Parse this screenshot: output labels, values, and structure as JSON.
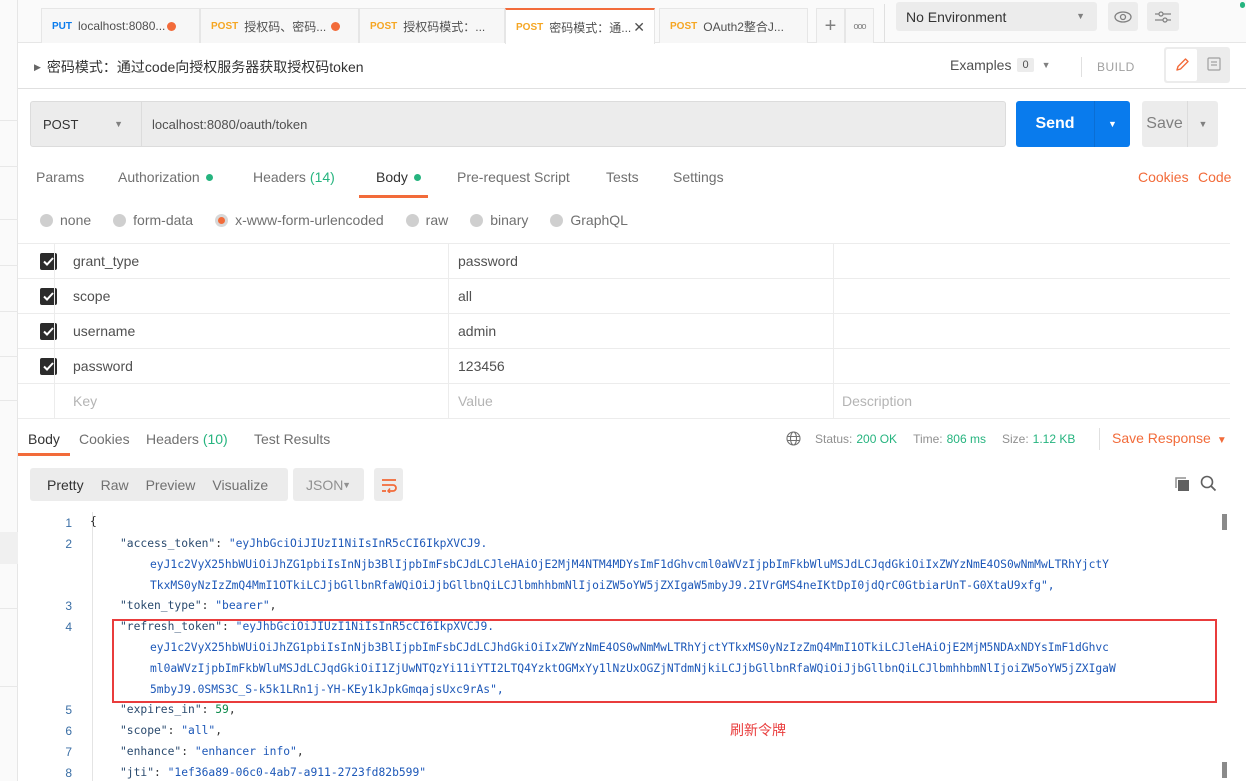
{
  "tabs": [
    {
      "method": "PUT",
      "title": "localhost:8080...",
      "unsaved": true,
      "active": false
    },
    {
      "method": "POST",
      "title": "授权码、密码...",
      "unsaved": true,
      "active": false
    },
    {
      "method": "POST",
      "title": "授权码模式：...",
      "unsaved": false,
      "active": false
    },
    {
      "method": "POST",
      "title": "密码模式：通...",
      "unsaved": false,
      "active": true,
      "close": "✕"
    },
    {
      "method": "POST",
      "title": "OAuth2整合J...",
      "unsaved": false,
      "active": false
    }
  ],
  "tabbar": {
    "add_label": "+",
    "more_label": "ooo"
  },
  "environment": {
    "selected": "No Environment"
  },
  "request": {
    "name": "密码模式：通过code向授权服务器获取授权码token",
    "examples_label": "Examples",
    "examples_count": "0",
    "build_label": "BUILD",
    "method": "POST",
    "url": "localhost:8080/oauth/token",
    "send_label": "Send",
    "save_label": "Save"
  },
  "request_tabs": [
    {
      "label": "Params"
    },
    {
      "label": "Authorization",
      "dot": true
    },
    {
      "label": "Headers",
      "count": "(14)"
    },
    {
      "label": "Body",
      "dot": true,
      "active": true
    },
    {
      "label": "Pre-request Script"
    },
    {
      "label": "Tests"
    },
    {
      "label": "Settings"
    }
  ],
  "links": {
    "cookies": "Cookies",
    "code": "Code"
  },
  "body_types": [
    {
      "label": "none"
    },
    {
      "label": "form-data"
    },
    {
      "label": "x-www-form-urlencoded",
      "selected": true
    },
    {
      "label": "raw"
    },
    {
      "label": "binary"
    },
    {
      "label": "GraphQL"
    }
  ],
  "params": [
    {
      "key": "grant_type",
      "value": "password",
      "checked": true
    },
    {
      "key": "scope",
      "value": "all",
      "checked": true
    },
    {
      "key": "username",
      "value": "admin",
      "checked": true
    },
    {
      "key": "password",
      "value": "123456",
      "checked": true
    }
  ],
  "params_placeholder": {
    "key": "Key",
    "value": "Value",
    "description": "Description"
  },
  "response_tabs": [
    {
      "label": "Body",
      "active": true
    },
    {
      "label": "Cookies"
    },
    {
      "label": "Headers",
      "count": "(10)"
    },
    {
      "label": "Test Results"
    }
  ],
  "response_status": {
    "status_label": "Status:",
    "status": "200 OK",
    "time_label": "Time:",
    "time": "806 ms",
    "size_label": "Size:",
    "size": "1.12 KB",
    "save_response": "Save Response"
  },
  "view_modes": [
    {
      "label": "Pretty",
      "active": true
    },
    {
      "label": "Raw"
    },
    {
      "label": "Preview"
    },
    {
      "label": "Visualize"
    }
  ],
  "format": {
    "selected": "JSON"
  },
  "code_lines": {
    "l1": {
      "num": "1",
      "text": "{"
    },
    "l2": {
      "num": "2",
      "key": "\"access_token\"",
      "sep": ": ",
      "parts": [
        "\"eyJhbGciOiJIUzI1NiIsInR5cCI6IkpXVCJ9.",
        "eyJ1c2VyX25hbWUiOiJhZG1pbiIsInNjb3BlIjpbImFsbCJdLCJleHAiOjE2MjM4NTM4MDYsImF1dGhvcml0aWVzIjpbImFkbWluMSJdLCJqdGkiOiIxZWYzNmE4OS0wNmMwLTRhYjctY",
        "TkxMS0yNzIzZmQ4MmI1OTkiLCJjbGllbnRfaWQiOiJjbGllbnQiLCJlbmhhbmNlIjoiZW5oYW5jZXIgaW5mbyJ9.2IVrGMS4neIKtDpI0jdQrC0GtbiarUnT-G0XtaU9xfg\","
      ]
    },
    "l3": {
      "num": "3",
      "key": "\"token_type\"",
      "sep": ": ",
      "value": "\"bearer\"",
      "end": ","
    },
    "l4": {
      "num": "4",
      "key": "\"refresh_token\"",
      "sep": ": ",
      "parts": [
        "\"eyJhbGciOiJIUzI1NiIsInR5cCI6IkpXVCJ9.",
        "eyJ1c2VyX25hbWUiOiJhZG1pbiIsInNjb3BlIjpbImFsbCJdLCJhdGkiOiIxZWYzNmE4OS0wNmMwLTRhYjctYTkxMS0yNzIzZmQ4MmI1OTkiLCJleHAiOjE2MjM5NDAxNDYsImF1dGhvc",
        "ml0aWVzIjpbImFkbWluMSJdLCJqdGkiOiI1ZjUwNTQzYi11iYTI2LTQ4YzktOGMxYy1lNzUxOGZjNTdmNjkiLCJjbGllbnRfaWQiOiJjbGllbnQiLCJlbmhhbmNlIjoiZW5oYW5jZXIgaW",
        "5mbyJ9.0SMS3C_S-k5k1LRn1j-YH-KEy1kJpkGmqajsUxc9rAs\","
      ]
    },
    "l5": {
      "num": "5",
      "key": "\"expires_in\"",
      "sep": ": ",
      "value": "59",
      "end": ","
    },
    "l6": {
      "num": "6",
      "key": "\"scope\"",
      "sep": ": ",
      "value": "\"all\"",
      "end": ","
    },
    "l7": {
      "num": "7",
      "key": "\"enhance\"",
      "sep": ": ",
      "value": "\"enhancer info\"",
      "end": ","
    },
    "l8": {
      "num": "8",
      "key": "\"jti\"",
      "sep": ": ",
      "value": "\"1ef36a89-06c0-4ab7-a911-2723fd82b599\"",
      "end": ""
    }
  },
  "annotation": "刷新令牌",
  "colors": {
    "accent": "#f26b3a",
    "send": "#097bed",
    "success": "#26b47f",
    "highlight": "#e93c3c"
  }
}
